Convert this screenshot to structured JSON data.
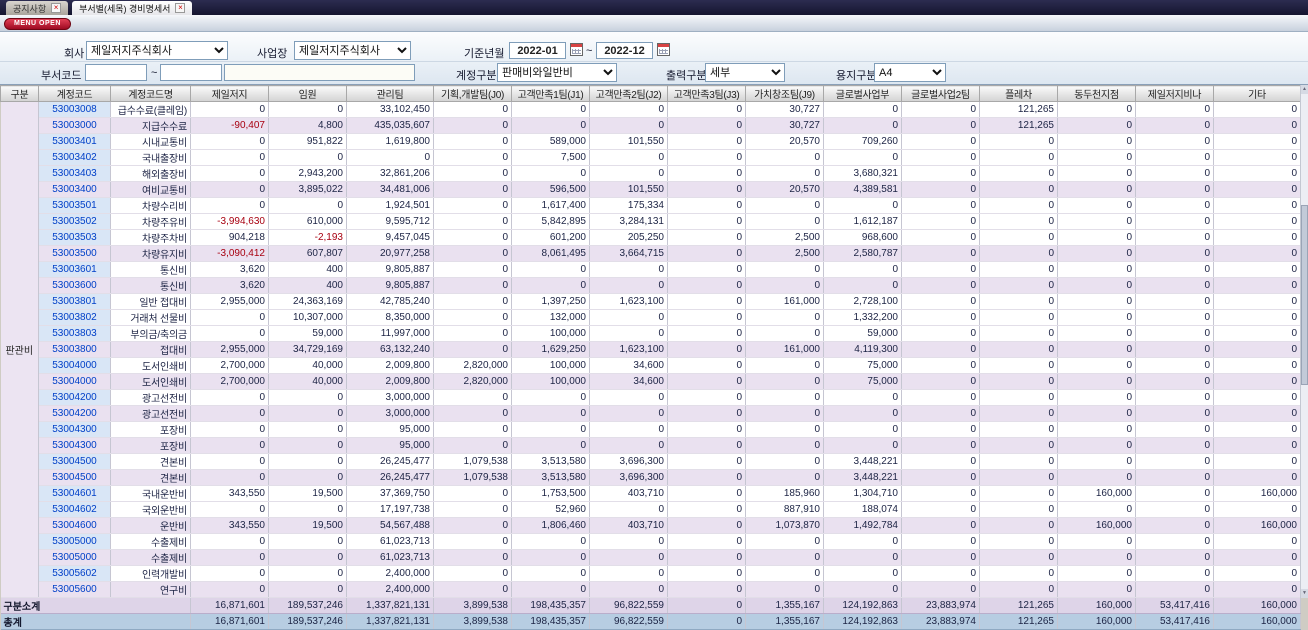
{
  "colors": {
    "tab_bar_bg": "#191935",
    "menu_button_red": "#c01830",
    "summary_row_bg": "#eae1f0",
    "subtotal_row_bg": "#ded4e8",
    "total_row_bg": "#b7cde2",
    "code_column_bg": "#d9e6f6",
    "code_text_blue": "#0040c8"
  },
  "tabs": [
    {
      "label": "공지사항"
    },
    {
      "label": "부서별(세목) 경비명세서"
    }
  ],
  "menu_open_label": "MENU OPEN",
  "filters": {
    "company_label": "회사",
    "company_value": "제일저지주식회사",
    "workplace_label": "사업장",
    "workplace_value": "제일저지주식회사",
    "period_label": "기준년월",
    "period_from": "2022-01",
    "period_to": "2022-12",
    "tilde": "~",
    "dept_code_label": "부서코드",
    "dept_code_from": "",
    "dept_code_to": "",
    "dept_name": "",
    "account_type_label": "계정구분",
    "account_type_value": "판매비와일반비",
    "output_type_label": "출력구분",
    "output_type_value": "세부",
    "paper_type_label": "용지구분",
    "paper_type_value": "A4"
  },
  "table": {
    "group_label": "판관비",
    "columns": [
      "구분",
      "계정코드",
      "계정코드명",
      "제일저지",
      "임원",
      "관리팀",
      "기획,개발팀(J0)",
      "고객만족1팀(J1)",
      "고객만족2팀(J2)",
      "고객만족3팀(J3)",
      "가치창조팀(J9)",
      "글로벌사업부",
      "글로벌사업2팀",
      "플레차",
      "동두천지점",
      "제일저지비나",
      "기타"
    ],
    "rows": [
      {
        "type": "detail",
        "code": "53003008",
        "name": "급수수료(클레임)",
        "values": [
          "0",
          "0",
          "33,102,450",
          "0",
          "0",
          "0",
          "0",
          "30,727",
          "0",
          "0",
          "121,265",
          "0",
          "0",
          "0"
        ]
      },
      {
        "type": "summary",
        "code": "53003000",
        "name": "지급수수료",
        "values": [
          "-90,407",
          "4,800",
          "435,035,607",
          "0",
          "0",
          "0",
          "0",
          "30,727",
          "0",
          "0",
          "121,265",
          "0",
          "0",
          "0"
        ]
      },
      {
        "type": "detail",
        "code": "53003401",
        "name": "시내교통비",
        "values": [
          "0",
          "951,822",
          "1,619,800",
          "0",
          "589,000",
          "101,550",
          "0",
          "20,570",
          "709,260",
          "0",
          "0",
          "0",
          "0",
          "0"
        ]
      },
      {
        "type": "detail",
        "code": "53003402",
        "name": "국내출장비",
        "values": [
          "0",
          "0",
          "0",
          "0",
          "7,500",
          "0",
          "0",
          "0",
          "0",
          "0",
          "0",
          "0",
          "0",
          "0"
        ]
      },
      {
        "type": "detail",
        "code": "53003403",
        "name": "해외출장비",
        "values": [
          "0",
          "2,943,200",
          "32,861,206",
          "0",
          "0",
          "0",
          "0",
          "0",
          "3,680,321",
          "0",
          "0",
          "0",
          "0",
          "0"
        ]
      },
      {
        "type": "summary",
        "code": "53003400",
        "name": "여비교통비",
        "values": [
          "0",
          "3,895,022",
          "34,481,006",
          "0",
          "596,500",
          "101,550",
          "0",
          "20,570",
          "4,389,581",
          "0",
          "0",
          "0",
          "0",
          "0"
        ]
      },
      {
        "type": "detail",
        "code": "53003501",
        "name": "차량수리비",
        "values": [
          "0",
          "0",
          "1,924,501",
          "0",
          "1,617,400",
          "175,334",
          "0",
          "0",
          "0",
          "0",
          "0",
          "0",
          "0",
          "0"
        ]
      },
      {
        "type": "detail",
        "code": "53003502",
        "name": "차량주유비",
        "values": [
          "-3,994,630",
          "610,000",
          "9,595,712",
          "0",
          "5,842,895",
          "3,284,131",
          "0",
          "0",
          "1,612,187",
          "0",
          "0",
          "0",
          "0",
          "0"
        ]
      },
      {
        "type": "detail",
        "code": "53003503",
        "name": "차량주차비",
        "values": [
          "904,218",
          "-2,193",
          "9,457,045",
          "0",
          "601,200",
          "205,250",
          "0",
          "2,500",
          "968,600",
          "0",
          "0",
          "0",
          "0",
          "0"
        ]
      },
      {
        "type": "summary",
        "code": "53003500",
        "name": "차량유지비",
        "values": [
          "-3,090,412",
          "607,807",
          "20,977,258",
          "0",
          "8,061,495",
          "3,664,715",
          "0",
          "2,500",
          "2,580,787",
          "0",
          "0",
          "0",
          "0",
          "0"
        ]
      },
      {
        "type": "detail",
        "code": "53003601",
        "name": "통신비",
        "values": [
          "3,620",
          "400",
          "9,805,887",
          "0",
          "0",
          "0",
          "0",
          "0",
          "0",
          "0",
          "0",
          "0",
          "0",
          "0"
        ]
      },
      {
        "type": "summary",
        "code": "53003600",
        "name": "통신비",
        "values": [
          "3,620",
          "400",
          "9,805,887",
          "0",
          "0",
          "0",
          "0",
          "0",
          "0",
          "0",
          "0",
          "0",
          "0",
          "0"
        ]
      },
      {
        "type": "detail",
        "code": "53003801",
        "name": "일반 접대비",
        "values": [
          "2,955,000",
          "24,363,169",
          "42,785,240",
          "0",
          "1,397,250",
          "1,623,100",
          "0",
          "161,000",
          "2,728,100",
          "0",
          "0",
          "0",
          "0",
          "0"
        ]
      },
      {
        "type": "detail",
        "code": "53003802",
        "name": "거래처 선물비",
        "values": [
          "0",
          "10,307,000",
          "8,350,000",
          "0",
          "132,000",
          "0",
          "0",
          "0",
          "1,332,200",
          "0",
          "0",
          "0",
          "0",
          "0"
        ]
      },
      {
        "type": "detail",
        "code": "53003803",
        "name": "부의금/축의금",
        "values": [
          "0",
          "59,000",
          "11,997,000",
          "0",
          "100,000",
          "0",
          "0",
          "0",
          "59,000",
          "0",
          "0",
          "0",
          "0",
          "0"
        ]
      },
      {
        "type": "summary",
        "code": "53003800",
        "name": "접대비",
        "values": [
          "2,955,000",
          "34,729,169",
          "63,132,240",
          "0",
          "1,629,250",
          "1,623,100",
          "0",
          "161,000",
          "4,119,300",
          "0",
          "0",
          "0",
          "0",
          "0"
        ]
      },
      {
        "type": "detail",
        "code": "53004000",
        "name": "도서인쇄비",
        "values": [
          "2,700,000",
          "40,000",
          "2,009,800",
          "2,820,000",
          "100,000",
          "34,600",
          "0",
          "0",
          "75,000",
          "0",
          "0",
          "0",
          "0",
          "0"
        ]
      },
      {
        "type": "summary",
        "code": "53004000",
        "name": "도서인쇄비",
        "values": [
          "2,700,000",
          "40,000",
          "2,009,800",
          "2,820,000",
          "100,000",
          "34,600",
          "0",
          "0",
          "75,000",
          "0",
          "0",
          "0",
          "0",
          "0"
        ]
      },
      {
        "type": "detail",
        "code": "53004200",
        "name": "광고선전비",
        "values": [
          "0",
          "0",
          "3,000,000",
          "0",
          "0",
          "0",
          "0",
          "0",
          "0",
          "0",
          "0",
          "0",
          "0",
          "0"
        ]
      },
      {
        "type": "summary",
        "code": "53004200",
        "name": "광고선전비",
        "values": [
          "0",
          "0",
          "3,000,000",
          "0",
          "0",
          "0",
          "0",
          "0",
          "0",
          "0",
          "0",
          "0",
          "0",
          "0"
        ]
      },
      {
        "type": "detail",
        "code": "53004300",
        "name": "포장비",
        "values": [
          "0",
          "0",
          "95,000",
          "0",
          "0",
          "0",
          "0",
          "0",
          "0",
          "0",
          "0",
          "0",
          "0",
          "0"
        ]
      },
      {
        "type": "summary",
        "code": "53004300",
        "name": "포장비",
        "values": [
          "0",
          "0",
          "95,000",
          "0",
          "0",
          "0",
          "0",
          "0",
          "0",
          "0",
          "0",
          "0",
          "0",
          "0"
        ]
      },
      {
        "type": "detail",
        "code": "53004500",
        "name": "견본비",
        "values": [
          "0",
          "0",
          "26,245,477",
          "1,079,538",
          "3,513,580",
          "3,696,300",
          "0",
          "0",
          "3,448,221",
          "0",
          "0",
          "0",
          "0",
          "0"
        ]
      },
      {
        "type": "summary",
        "code": "53004500",
        "name": "견본비",
        "values": [
          "0",
          "0",
          "26,245,477",
          "1,079,538",
          "3,513,580",
          "3,696,300",
          "0",
          "0",
          "3,448,221",
          "0",
          "0",
          "0",
          "0",
          "0"
        ]
      },
      {
        "type": "detail",
        "code": "53004601",
        "name": "국내운반비",
        "values": [
          "343,550",
          "19,500",
          "37,369,750",
          "0",
          "1,753,500",
          "403,710",
          "0",
          "185,960",
          "1,304,710",
          "0",
          "0",
          "160,000",
          "0",
          "160,000"
        ]
      },
      {
        "type": "detail",
        "code": "53004602",
        "name": "국외운반비",
        "values": [
          "0",
          "0",
          "17,197,738",
          "0",
          "52,960",
          "0",
          "0",
          "887,910",
          "188,074",
          "0",
          "0",
          "0",
          "0",
          "0"
        ]
      },
      {
        "type": "summary",
        "code": "53004600",
        "name": "운반비",
        "values": [
          "343,550",
          "19,500",
          "54,567,488",
          "0",
          "1,806,460",
          "403,710",
          "0",
          "1,073,870",
          "1,492,784",
          "0",
          "0",
          "160,000",
          "0",
          "160,000"
        ]
      },
      {
        "type": "detail",
        "code": "53005000",
        "name": "수출제비",
        "values": [
          "0",
          "0",
          "61,023,713",
          "0",
          "0",
          "0",
          "0",
          "0",
          "0",
          "0",
          "0",
          "0",
          "0",
          "0"
        ]
      },
      {
        "type": "summary",
        "code": "53005000",
        "name": "수출제비",
        "values": [
          "0",
          "0",
          "61,023,713",
          "0",
          "0",
          "0",
          "0",
          "0",
          "0",
          "0",
          "0",
          "0",
          "0",
          "0"
        ]
      },
      {
        "type": "detail",
        "code": "53005602",
        "name": "인력개발비",
        "values": [
          "0",
          "0",
          "2,400,000",
          "0",
          "0",
          "0",
          "0",
          "0",
          "0",
          "0",
          "0",
          "0",
          "0",
          "0"
        ]
      },
      {
        "type": "summary",
        "code": "53005600",
        "name": "연구비",
        "values": [
          "0",
          "0",
          "2,400,000",
          "0",
          "0",
          "0",
          "0",
          "0",
          "0",
          "0",
          "0",
          "0",
          "0",
          "0"
        ]
      }
    ],
    "subtotal": {
      "label": "구분소계",
      "values": [
        "16,871,601",
        "189,537,246",
        "1,337,821,131",
        "3,899,538",
        "198,435,357",
        "96,822,559",
        "0",
        "1,355,167",
        "124,192,863",
        "23,883,974",
        "121,265",
        "160,000",
        "53,417,416",
        "160,000"
      ]
    },
    "total": {
      "label": "총계",
      "values": [
        "16,871,601",
        "189,537,246",
        "1,337,821,131",
        "3,899,538",
        "198,435,357",
        "96,822,559",
        "0",
        "1,355,167",
        "124,192,863",
        "23,883,974",
        "121,265",
        "160,000",
        "53,417,416",
        "160,000"
      ]
    }
  }
}
